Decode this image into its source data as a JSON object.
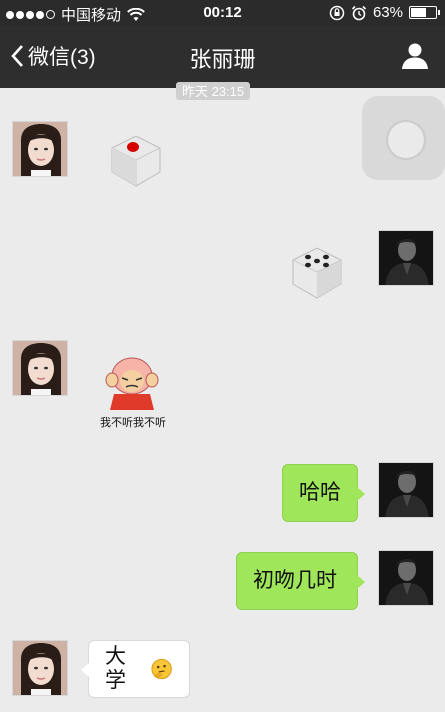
{
  "status": {
    "carrier": "中国移动",
    "time": "00:12",
    "battery": "63%",
    "battery_level": 0.63
  },
  "nav": {
    "back_label": "微信(3)",
    "title": "张丽珊"
  },
  "chat": {
    "timestamp": "昨天 23:15",
    "messages": [
      {
        "from": "girl",
        "type": "dice",
        "value": 1
      },
      {
        "from": "me",
        "type": "dice",
        "value": 5
      },
      {
        "from": "girl",
        "type": "sticker",
        "caption": "我不听我不听"
      },
      {
        "from": "me",
        "type": "text",
        "text": "哈哈"
      },
      {
        "from": "me",
        "type": "text",
        "text": "初吻几时"
      },
      {
        "from": "girl",
        "type": "text",
        "text": "大学",
        "emoji": "thinking-face"
      }
    ]
  },
  "colors": {
    "nav_bg": "#2e2e2e",
    "chat_bg": "#ebebeb",
    "bubble_green": "#9fe65b",
    "bubble_white": "#ffffff"
  }
}
